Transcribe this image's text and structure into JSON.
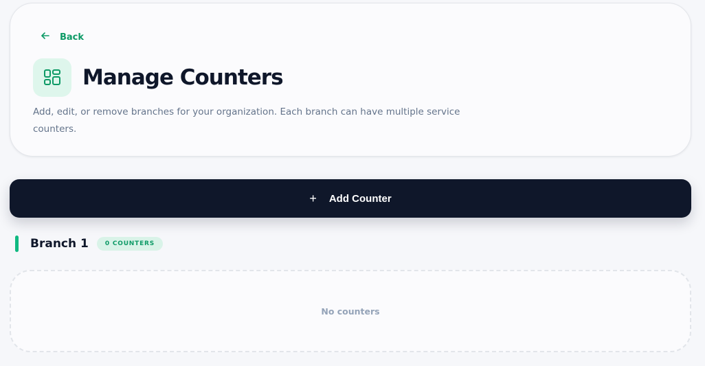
{
  "header": {
    "back_label": "Back",
    "title": "Manage Counters",
    "subtitle": "Add, edit, or remove branches for your organization. Each branch can have multiple service counters.",
    "back_icon": "arrow-left-icon",
    "title_icon": "dashboard-grid-icon"
  },
  "actions": {
    "add_counter_label": "Add Counter",
    "add_icon": "plus-icon"
  },
  "branches": [
    {
      "name": "Branch 1",
      "count_label": "0 COUNTERS",
      "empty_text": "No counters"
    }
  ],
  "colors": {
    "accent": "#0d9a66",
    "accent_light": "#def6ec",
    "dark": "#0f172a",
    "muted": "#64748b",
    "branch_bar": "#10b981"
  }
}
